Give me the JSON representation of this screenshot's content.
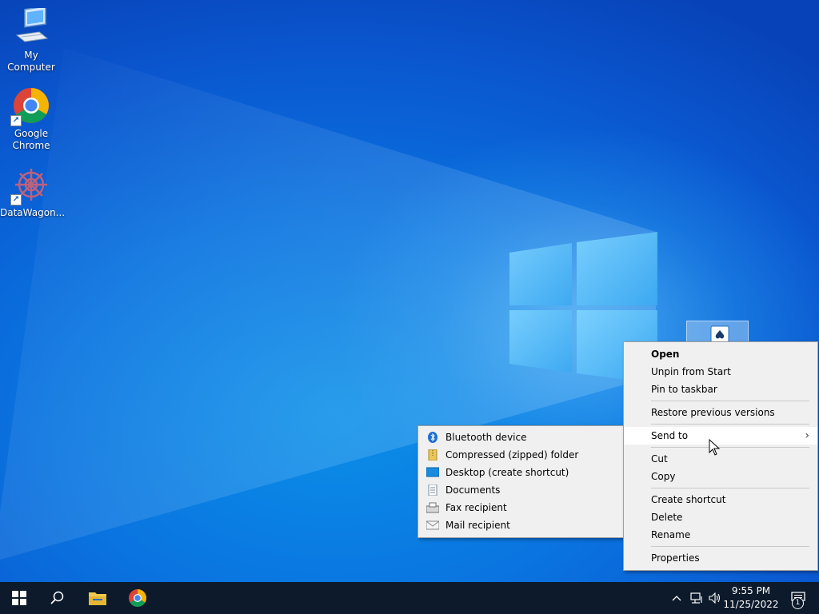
{
  "desktop": {
    "icons": [
      {
        "label": "My Computer",
        "icon": "computer-icon"
      },
      {
        "label": "Google Chrome",
        "icon": "chrome-icon"
      },
      {
        "label": "DataWagon...",
        "icon": "datawagon-icon"
      }
    ]
  },
  "context_menu": {
    "items": [
      {
        "label": "Open",
        "bold": true
      },
      {
        "label": "Unpin from Start"
      },
      {
        "label": "Pin to taskbar"
      },
      {
        "label": "Restore previous versions"
      },
      {
        "label": "Send to",
        "has_submenu": true,
        "chevron": "›"
      },
      {
        "label": "Cut"
      },
      {
        "label": "Copy"
      },
      {
        "label": "Create shortcut"
      },
      {
        "label": "Delete"
      },
      {
        "label": "Rename"
      },
      {
        "label": "Properties"
      }
    ]
  },
  "send_to_menu": {
    "items": [
      {
        "label": "Bluetooth device",
        "icon": "bluetooth-icon"
      },
      {
        "label": "Compressed (zipped) folder",
        "icon": "zip-folder-icon"
      },
      {
        "label": "Desktop (create shortcut)",
        "icon": "desktop-icon"
      },
      {
        "label": "Documents",
        "icon": "documents-icon"
      },
      {
        "label": "Fax recipient",
        "icon": "fax-icon"
      },
      {
        "label": "Mail recipient",
        "icon": "mail-icon"
      }
    ]
  },
  "taskbar": {
    "time": "9:55 PM",
    "date": "11/25/2022",
    "notification_count": "1"
  },
  "colors": {
    "accent": "#0a74e0",
    "taskbar": "#0c1a2b",
    "menu_bg": "#f0f0f0"
  }
}
